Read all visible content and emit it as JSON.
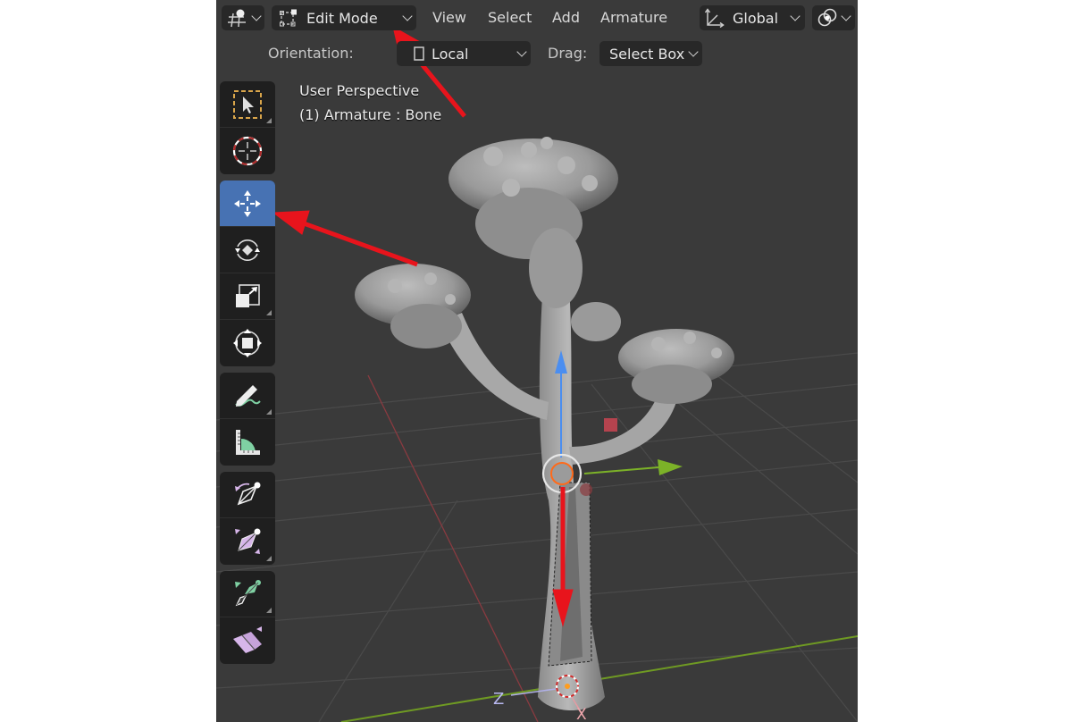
{
  "header": {
    "mode_selector": {
      "label": "Edit Mode",
      "icon": "edit-mode-icon"
    },
    "menus": [
      "View",
      "Select",
      "Add",
      "Armature"
    ],
    "transform_orientation": {
      "label": "Global",
      "icon": "transform-orientation-icon"
    },
    "pivot_icon": "pivot-snapping-icon"
  },
  "tool_settings": {
    "orientation_label": "Orientation:",
    "orientation_value": "Local",
    "drag_label": "Drag:",
    "drag_value": "Select Box"
  },
  "viewport_info": {
    "view_name": "User Perspective",
    "object_info": "(1) Armature : Bone"
  },
  "toolbar": {
    "groups": [
      [
        {
          "name": "select-box",
          "icon": "select-box-icon",
          "active": false,
          "submenu": true
        },
        {
          "name": "cursor",
          "icon": "cursor-icon",
          "active": false,
          "submenu": false
        }
      ],
      [
        {
          "name": "move",
          "icon": "move-icon",
          "active": true,
          "submenu": false
        },
        {
          "name": "rotate",
          "icon": "rotate-icon",
          "active": false,
          "submenu": false
        },
        {
          "name": "scale",
          "icon": "scale-icon",
          "active": false,
          "submenu": true
        },
        {
          "name": "transform",
          "icon": "transform-icon",
          "active": false,
          "submenu": false
        }
      ],
      [
        {
          "name": "annotate",
          "icon": "annotate-icon",
          "active": false,
          "submenu": true
        },
        {
          "name": "measure",
          "icon": "measure-icon",
          "active": false,
          "submenu": false
        }
      ],
      [
        {
          "name": "roll",
          "icon": "bone-roll-icon",
          "active": false,
          "submenu": false
        },
        {
          "name": "bone-size",
          "icon": "bone-size-icon",
          "active": false,
          "submenu": true
        }
      ],
      [
        {
          "name": "extrude",
          "icon": "extrude-icon",
          "active": false,
          "submenu": true
        },
        {
          "name": "shear",
          "icon": "shear-icon",
          "active": false,
          "submenu": false
        }
      ]
    ]
  },
  "gizmo_labels": {
    "z_axis": "Z",
    "x_axis": "X"
  },
  "colors": {
    "viewport_bg": "#3a3a3a",
    "header_button": "#282828",
    "active_tool": "#4772b3",
    "annotation_arrow": "#e8141c",
    "axis_x": "#c84a55",
    "axis_y": "#7cb228",
    "axis_z": "#4b8ef0",
    "bone_accent": "#d7b6ea",
    "measure_accent": "#7fd1a3"
  }
}
